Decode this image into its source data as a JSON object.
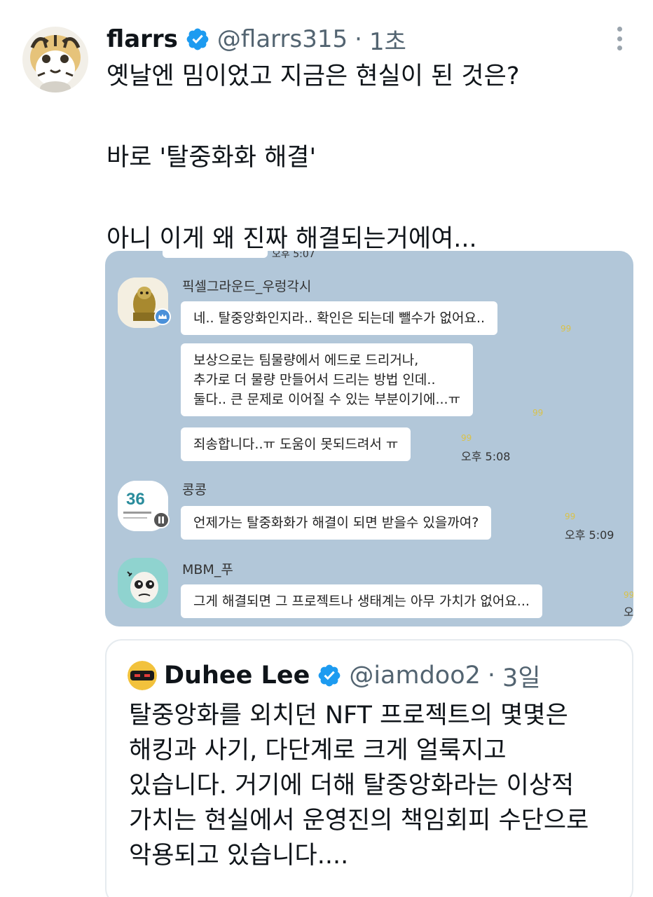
{
  "tweet": {
    "author_name": "flarrs",
    "handle": "@flarrs315",
    "separator": "·",
    "time": "1초",
    "lines": [
      "옛날엔 밈이었고 지금은 현실이 된 것은?",
      "",
      "바로 '탈중화화 해결'",
      "",
      "아니 이게 왜 진짜 해결되는거에여..."
    ]
  },
  "chat": {
    "top_partial_time": "오후 5:07",
    "messages": [
      {
        "sender": "픽셀그라운드_우렁각시",
        "bubbles": [
          {
            "lines": [
              "네.. 탈중앙화인지라.. 확인은 되는데 뺄수가 없어요.."
            ],
            "count": "99"
          },
          {
            "lines": [
              "보상으로는 팀물량에서 에드로 드리거나,",
              "추가로 더 물량 만들어서 드리는 방법 인데..",
              "둘다.. 큰 문제로 이어질 수 있는 부분이기에...ㅠ"
            ],
            "count": "99"
          },
          {
            "lines": [
              "죄송합니다..ㅠ 도움이 못되드려서 ㅠ"
            ],
            "count": "99",
            "time": "오후 5:08"
          }
        ]
      },
      {
        "sender": "콩콩",
        "avatar_text": "36",
        "bubbles": [
          {
            "lines": [
              "언제가는 탈중화화가 해결이 되면 받을수 있을까여?"
            ],
            "count": "99",
            "time": "오후 5:09"
          }
        ]
      },
      {
        "sender": "MBM_푸",
        "bubbles": [
          {
            "lines": [
              "그게 해결되면 그 프로젝트나 생태계는 아무 가치가 없어요..."
            ],
            "count": "99",
            "time": "오"
          }
        ]
      }
    ]
  },
  "quote": {
    "author_name": "Duhee Lee",
    "handle": "@iamdoo2",
    "separator": "·",
    "time": "3일",
    "lines": [
      "탈중앙화를 외치던 NFT 프로젝트의 몇몇은",
      "해킹과 사기, 다단계로 크게 얼룩지고",
      "있습니다. 거기에 더해 탈중앙화라는 이상적",
      "가치는 현실에서 운영진의 책임회피 수단으로",
      "악용되고 있습니다...."
    ]
  },
  "colors": {
    "verified": "#1d9bf0",
    "chat_bg": "#b2c7d9",
    "secondary_text": "#536471"
  },
  "icons": [
    "verified-badge-icon",
    "more-options-icon",
    "crown-badge-icon",
    "bot-badge-icon"
  ]
}
